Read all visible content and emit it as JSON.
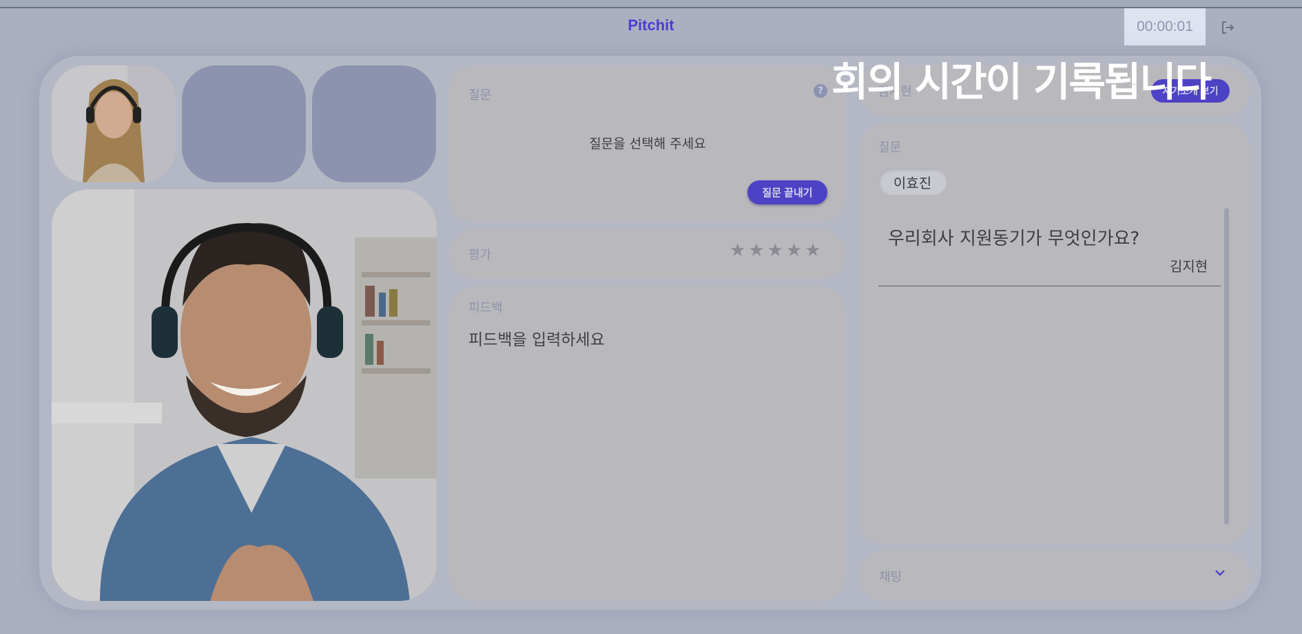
{
  "app": {
    "brand": "Pitchit",
    "timer": "00:00:01",
    "overlay_message": "회의 시간이 기록됩니다"
  },
  "question_panel": {
    "label": "질문",
    "prompt": "질문을 선택해 주세요",
    "end_button": "질문 끝내기"
  },
  "rating_panel": {
    "label": "평가",
    "stars_total": 5,
    "stars_filled": 0
  },
  "feedback_panel": {
    "label": "피드백",
    "placeholder": "피드백을 입력하세요"
  },
  "candidate": {
    "name": "김지현",
    "profile_button": "자기소개 보기"
  },
  "questions_list": {
    "label": "질문",
    "asker_chip": "이효진",
    "items": [
      {
        "question": "우리회사 지원동기가 무엇인가요?",
        "author": "김지현"
      }
    ]
  },
  "chat": {
    "label": "채팅"
  },
  "colors": {
    "accent": "#4d42c4",
    "background": "#aab0c0",
    "panel": "#b9b9bd"
  },
  "icons": {
    "help": "help-icon",
    "exit": "logout-icon",
    "star": "star-icon",
    "chevron": "chevron-down-icon"
  }
}
